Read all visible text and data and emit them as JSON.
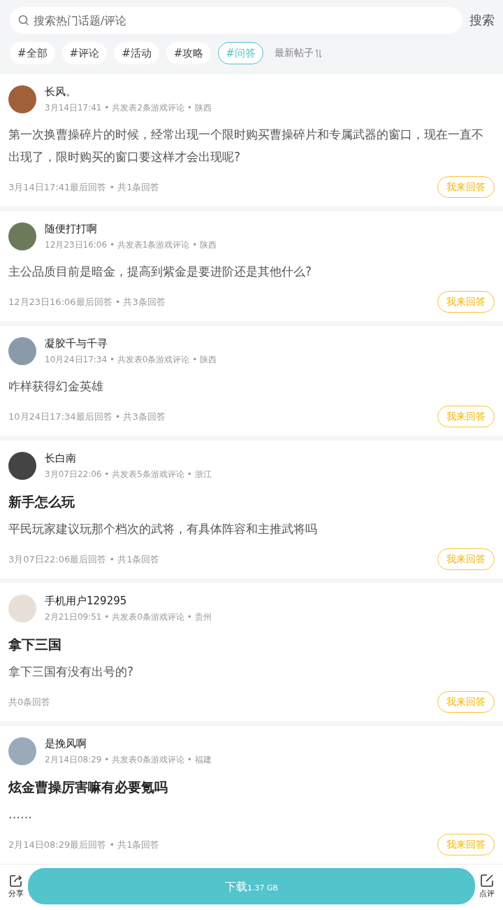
{
  "search": {
    "placeholder": "搜索热门话题/评论",
    "button": "搜索"
  },
  "filters": [
    {
      "label": "#全部",
      "selected": false
    },
    {
      "label": "#评论",
      "selected": false
    },
    {
      "label": "#活动",
      "selected": false
    },
    {
      "label": "#攻略",
      "selected": false
    },
    {
      "label": "#问答",
      "selected": true
    }
  ],
  "sort": {
    "label": "最新帖子"
  },
  "posts": [
    {
      "author": "长风。",
      "meta": "3月14日17:41 • 共发表2条游戏评论 • 陕西",
      "body": "第一次换曹操碎片的时候，经常出现一个限时购买曹操碎片和专属武器的窗口，现在一直不出现了，限时购买的窗口要这样才会出现呢?",
      "footer": "3月14日17:41最后回答 • 共1条回答",
      "action": "我来回答"
    },
    {
      "author": "随便打打啊",
      "meta": "12月23日16:06 • 共发表1条游戏评论 • 陕西",
      "body": "主公品质目前是暗金，提高到紫金是要进阶还是其他什么?",
      "footer": "12月23日16:06最后回答 • 共3条回答",
      "action": "我来回答"
    },
    {
      "author": "凝胶千与千寻",
      "meta": "10月24日17:34 • 共发表0条游戏评论 • 陕西",
      "body": "咋样获得幻金英雄",
      "footer": "10月24日17:34最后回答 • 共3条回答",
      "action": "我来回答"
    },
    {
      "author": "长白南",
      "meta": "3月07日22:06 • 共发表5条游戏评论 • 浙江",
      "title": "新手怎么玩",
      "body": "平民玩家建议玩那个档次的武将，有具体阵容和主推武将吗",
      "footer": "3月07日22:06最后回答 • 共1条回答",
      "action": "我来回答"
    },
    {
      "author": "手机用户129295",
      "meta": "2月21日09:51 • 共发表0条游戏评论 • 贵州",
      "title": "拿下三国",
      "body": "拿下三国有没有出号的?",
      "footer": "共0条回答",
      "action": "我来回答"
    },
    {
      "author": "是挽风啊",
      "meta": "2月14日08:29 • 共发表0条游戏评论 • 福建",
      "title": "炫金曹操厉害嘛有必要氪吗",
      "body": "……",
      "footer": "2月14日08:29最后回答 • 共1条回答",
      "action": "我来回答"
    }
  ],
  "bottom_bar": {
    "share": "分享",
    "download": "下载",
    "size": "1.37 GB",
    "review": "点评"
  }
}
